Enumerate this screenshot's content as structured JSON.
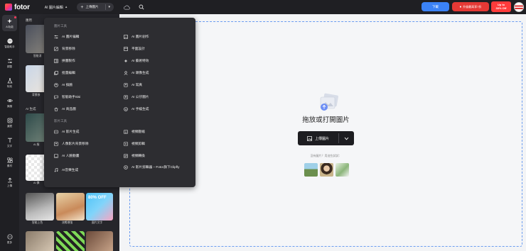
{
  "topbar": {
    "logo_text": "fotor",
    "editor_menu": "AI 圖片編輯",
    "upload_label": "上傳圖片",
    "download_label": "下載",
    "pro_label": "升級最高享7折",
    "offer_line1": "Up to",
    "offer_line2": "30% Off"
  },
  "rail": {
    "items": [
      {
        "label": "AI功能",
        "icon": "sparkle-icon"
      },
      {
        "label": "智能助手",
        "icon": "assistant-icon"
      },
      {
        "label": "調整",
        "icon": "sliders-icon"
      },
      {
        "label": "特效",
        "icon": "flask-icon"
      },
      {
        "label": "美顏",
        "icon": "eye-icon"
      },
      {
        "label": "濾鏡",
        "icon": "frame-icon"
      },
      {
        "label": "文字",
        "icon": "text-icon"
      },
      {
        "label": "素材",
        "icon": "elements-icon"
      },
      {
        "label": "上傳",
        "icon": "upload-icon"
      },
      {
        "label": "更多",
        "icon": "more-icon"
      }
    ]
  },
  "panel": {
    "heading": "應用",
    "section_ai": "AI 生成",
    "tile_labels": [
      "智能消",
      "背景移",
      "AI 服",
      "AI 擴"
    ],
    "bottom_tiles": [
      "智能上色",
      "流暢增強",
      "圖片文字"
    ]
  },
  "dropdown": {
    "section1": "圖片工具",
    "section2": "影片工具",
    "left_items": [
      {
        "label": "AI 圖片編輯",
        "icon": "sliders-icon"
      },
      {
        "label": "背景移除",
        "icon": "bg-remove-icon"
      },
      {
        "label": "拼圖製作",
        "icon": "collage-icon"
      },
      {
        "label": "批量編輯",
        "icon": "batch-icon"
      },
      {
        "label": "AI 換臉",
        "icon": "face-swap-icon"
      },
      {
        "label": "智能助手Sisi",
        "icon": "chat-icon"
      },
      {
        "label": "AI 商品圖",
        "icon": "product-icon"
      }
    ],
    "right_items": [
      {
        "label": "AI 圖片創作",
        "icon": "image-create-icon"
      },
      {
        "label": "平面設計",
        "icon": "design-icon"
      },
      {
        "label": "AI 藝術特效",
        "icon": "art-effect-icon"
      },
      {
        "label": "AI 頭像生成",
        "icon": "avatar-gen-icon"
      },
      {
        "label": "AI 寫真",
        "icon": "portrait-icon"
      },
      {
        "label": "AI 公仔圖片",
        "icon": "figure-icon"
      },
      {
        "label": "AI 手繪生成",
        "icon": "sketch-icon"
      }
    ],
    "video_left": [
      {
        "label": "AI 影片生成",
        "icon": "video-gen-icon"
      },
      {
        "label": "人像影片背景移除",
        "icon": "video-bg-icon"
      },
      {
        "label": "AI 人臉動畫",
        "icon": "face-anim-icon"
      },
      {
        "label": "AI音樂生成",
        "icon": "music-icon"
      }
    ],
    "video_right": [
      {
        "label": "視頻壓縮",
        "icon": "compress-icon"
      },
      {
        "label": "視頻剪輯",
        "icon": "clip-icon"
      },
      {
        "label": "視頻轉換",
        "icon": "convert-icon"
      },
      {
        "label": "AI 影片剪輯器 – Fotor旗下Clipfly",
        "icon": "clipfly-icon"
      }
    ]
  },
  "canvas": {
    "drop_title": "拖放或打開圖片",
    "upload_button": "上傳圖片",
    "try_text": "沒有圖片？用這些試試："
  },
  "colors": {
    "dark_bg": "#1f1f23",
    "panel_bg": "#26262b",
    "menu_bg": "#2d2d31",
    "download_blue": "#3b82f6",
    "pro_red": "#e53935",
    "canvas_border": "#6b9cf0"
  }
}
